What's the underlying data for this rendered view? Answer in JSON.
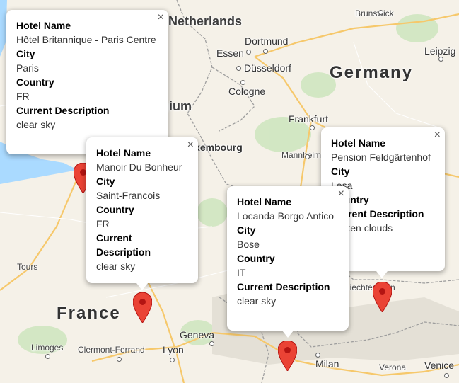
{
  "map": {
    "cities": {
      "brunswick": "Brunswick",
      "dortmund": "Dortmund",
      "essen": "Essen",
      "dusseldorf": "Düsseldorf",
      "cologne": "Cologne",
      "leipzig": "Leipzig",
      "frankfurt": "Frankfurt",
      "mannheim": "Mannheim",
      "tours": "Tours",
      "limoges": "Limoges",
      "clermont": "Clermont-Ferrand",
      "lyon": "Lyon",
      "geneva": "Geneva",
      "milan": "Milan",
      "verona": "Verona",
      "venice": "Venice",
      "liechtenstein": "Liechtenstein"
    },
    "regions": {
      "netherlands": "Netherlands",
      "germany": "Germany",
      "france": "France",
      "belgium": "Belgium",
      "luxembourg": "Luxembourg"
    },
    "marker_color": "#ea4335"
  },
  "popups": [
    {
      "hotel_label": "Hotel Name",
      "hotel": "Hôtel Britannique - Paris Centre",
      "city_label": "City",
      "city": "Paris",
      "country_label": "Country",
      "country": "FR",
      "desc_label": "Current Description",
      "desc": "clear sky",
      "close": "×"
    },
    {
      "hotel_label": "Hotel Name",
      "hotel": "Manoir Du Bonheur",
      "city_label": "City",
      "city": "Saint-Francois",
      "country_label": "Country",
      "country": "FR",
      "desc_label": "Current Description",
      "desc": "clear sky",
      "close": "×"
    },
    {
      "hotel_label": "Hotel Name",
      "hotel": "Locanda Borgo Antico",
      "city_label": "City",
      "city": "Bose",
      "country_label": "Country",
      "country": "IT",
      "desc_label": "Current Description",
      "desc": "clear sky",
      "close": "×"
    },
    {
      "hotel_label": "Hotel Name",
      "hotel": "Pension Feldgärtenhof",
      "city_label": "City",
      "city": "Lesa",
      "country_label": "Country",
      "country": "",
      "desc_label": "Current Description",
      "desc": "broken clouds",
      "close": "×"
    }
  ]
}
